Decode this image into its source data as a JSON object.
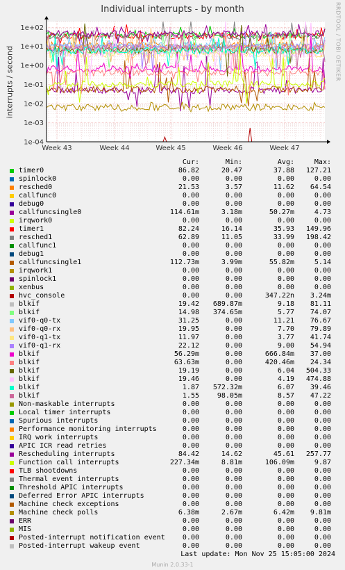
{
  "title": "Individual interrupts - by month",
  "ylabel": "interrupts / second",
  "credit": "RRDTOOL / TOBI OETIKER",
  "legend_headers": {
    "cur": "Cur:",
    "min": "Min:",
    "avg": "Avg:",
    "max": "Max:"
  },
  "footer": {
    "last_update": "Last update:  Mon Nov 25 15:05:00 2024",
    "version": "Munin 2.0.33-1"
  },
  "chart_data": {
    "type": "line",
    "title": "Individual interrupts - by month",
    "ylabel": "interrupts / second",
    "xlabel": "",
    "y_scale": "log",
    "ylim": [
      0.0001,
      200
    ],
    "y_ticks": [
      "1e+02",
      "1e+01",
      "1e+00",
      "1e-01",
      "1e-02",
      "1e-03",
      "1e-04"
    ],
    "x_ticks": [
      "Week 43",
      "Week 44",
      "Week 45",
      "Week 46",
      "Week 47"
    ],
    "grid": true,
    "legend_position": "bottom",
    "series": [
      {
        "name": "timer0",
        "color": "#00cc00",
        "cur": "86.82",
        "min": "20.47",
        "avg": "37.88",
        "max": "127.21"
      },
      {
        "name": "spinlock0",
        "color": "#0066b3",
        "cur": "0.00",
        "min": "0.00",
        "avg": "0.00",
        "max": "0.00"
      },
      {
        "name": "resched0",
        "color": "#ff8000",
        "cur": "21.53",
        "min": "3.57",
        "avg": "11.62",
        "max": "64.54"
      },
      {
        "name": "callfunc0",
        "color": "#ffcc00",
        "cur": "0.00",
        "min": "0.00",
        "avg": "0.00",
        "max": "0.00"
      },
      {
        "name": "debug0",
        "color": "#330099",
        "cur": "0.00",
        "min": "0.00",
        "avg": "0.00",
        "max": "0.00"
      },
      {
        "name": "callfuncsingle0",
        "color": "#990099",
        "cur": "114.61m",
        "min": "3.18m",
        "avg": "50.27m",
        "max": "4.73"
      },
      {
        "name": "irqwork0",
        "color": "#ccff00",
        "cur": "0.00",
        "min": "0.00",
        "avg": "0.00",
        "max": "0.00"
      },
      {
        "name": "timer1",
        "color": "#ff0000",
        "cur": "82.24",
        "min": "16.14",
        "avg": "35.93",
        "max": "149.96"
      },
      {
        "name": "resched1",
        "color": "#808080",
        "cur": "62.89",
        "min": "11.05",
        "avg": "33.99",
        "max": "198.42"
      },
      {
        "name": "callfunc1",
        "color": "#008f00",
        "cur": "0.00",
        "min": "0.00",
        "avg": "0.00",
        "max": "0.00"
      },
      {
        "name": "debug1",
        "color": "#00487d",
        "cur": "0.00",
        "min": "0.00",
        "avg": "0.00",
        "max": "0.00"
      },
      {
        "name": "callfuncsingle1",
        "color": "#b35a00",
        "cur": "112.73m",
        "min": "3.99m",
        "avg": "55.82m",
        "max": "5.14"
      },
      {
        "name": "irqwork1",
        "color": "#b38f00",
        "cur": "0.00",
        "min": "0.00",
        "avg": "0.00",
        "max": "0.00"
      },
      {
        "name": "spinlock1",
        "color": "#6b006b",
        "cur": "0.00",
        "min": "0.00",
        "avg": "0.00",
        "max": "0.00"
      },
      {
        "name": "xenbus",
        "color": "#8fb300",
        "cur": "0.00",
        "min": "0.00",
        "avg": "0.00",
        "max": "0.00"
      },
      {
        "name": "hvc_console",
        "color": "#b30000",
        "cur": "0.00",
        "min": "0.00",
        "avg": "347.22n",
        "max": "3.24m"
      },
      {
        "name": "blkif",
        "color": "#bebebe",
        "cur": "19.42",
        "min": "689.87m",
        "avg": "9.18",
        "max": "81.11"
      },
      {
        "name": "blkif",
        "color": "#80ff80",
        "cur": "14.98",
        "min": "374.65m",
        "avg": "5.77",
        "max": "74.07"
      },
      {
        "name": "vif0-q0-tx",
        "color": "#80c9ff",
        "cur": "31.25",
        "min": "0.00",
        "avg": "11.21",
        "max": "76.67"
      },
      {
        "name": "vif0-q0-rx",
        "color": "#ffc080",
        "cur": "19.95",
        "min": "0.00",
        "avg": "7.70",
        "max": "79.89"
      },
      {
        "name": "vif0-q1-tx",
        "color": "#ffe680",
        "cur": "11.97",
        "min": "0.00",
        "avg": "3.77",
        "max": "41.74"
      },
      {
        "name": "vif0-q1-rx",
        "color": "#aa80ff",
        "cur": "22.12",
        "min": "0.00",
        "avg": "9.00",
        "max": "54.94"
      },
      {
        "name": "blkif",
        "color": "#ee00cc",
        "cur": "56.29m",
        "min": "0.00",
        "avg": "666.84m",
        "max": "37.00"
      },
      {
        "name": "blkif",
        "color": "#ff8080",
        "cur": "63.63m",
        "min": "0.00",
        "avg": "420.46m",
        "max": "24.34"
      },
      {
        "name": "blkif",
        "color": "#666600",
        "cur": "19.19",
        "min": "0.00",
        "avg": "6.04",
        "max": "504.33"
      },
      {
        "name": "blkif",
        "color": "#ffbfff",
        "cur": "19.46",
        "min": "0.00",
        "avg": "4.19",
        "max": "474.88"
      },
      {
        "name": "blkif",
        "color": "#00ffcc",
        "cur": "1.87",
        "min": "572.32m",
        "avg": "6.07",
        "max": "39.46"
      },
      {
        "name": "blkif",
        "color": "#cc6699",
        "cur": "1.55",
        "min": "98.05m",
        "avg": "8.57",
        "max": "47.22"
      },
      {
        "name": "Non-maskable interrupts",
        "color": "#999900",
        "cur": "0.00",
        "min": "0.00",
        "avg": "0.00",
        "max": "0.00"
      },
      {
        "name": "Local timer interrupts",
        "color": "#00cc00",
        "cur": "0.00",
        "min": "0.00",
        "avg": "0.00",
        "max": "0.00"
      },
      {
        "name": "Spurious interrupts",
        "color": "#0066b3",
        "cur": "0.00",
        "min": "0.00",
        "avg": "0.00",
        "max": "0.00"
      },
      {
        "name": "Performance monitoring interrupts",
        "color": "#ff8000",
        "cur": "0.00",
        "min": "0.00",
        "avg": "0.00",
        "max": "0.00"
      },
      {
        "name": "IRQ work interrupts",
        "color": "#ffcc00",
        "cur": "0.00",
        "min": "0.00",
        "avg": "0.00",
        "max": "0.00"
      },
      {
        "name": "APIC ICR read retries",
        "color": "#330099",
        "cur": "0.00",
        "min": "0.00",
        "avg": "0.00",
        "max": "0.00"
      },
      {
        "name": "Rescheduling interrupts",
        "color": "#990099",
        "cur": "84.42",
        "min": "14.62",
        "avg": "45.61",
        "max": "257.77"
      },
      {
        "name": "Function call interrupts",
        "color": "#ccff00",
        "cur": "227.34m",
        "min": "8.81m",
        "avg": "106.09m",
        "max": "9.87"
      },
      {
        "name": "TLB shootdowns",
        "color": "#ff0000",
        "cur": "0.00",
        "min": "0.00",
        "avg": "0.00",
        "max": "0.00"
      },
      {
        "name": "Thermal event interrupts",
        "color": "#808080",
        "cur": "0.00",
        "min": "0.00",
        "avg": "0.00",
        "max": "0.00"
      },
      {
        "name": "Threshold APIC interrupts",
        "color": "#008f00",
        "cur": "0.00",
        "min": "0.00",
        "avg": "0.00",
        "max": "0.00"
      },
      {
        "name": "Deferred Error APIC interrupts",
        "color": "#00487d",
        "cur": "0.00",
        "min": "0.00",
        "avg": "0.00",
        "max": "0.00"
      },
      {
        "name": "Machine check exceptions",
        "color": "#b35a00",
        "cur": "0.00",
        "min": "0.00",
        "avg": "0.00",
        "max": "0.00"
      },
      {
        "name": "Machine check polls",
        "color": "#b38f00",
        "cur": "6.38m",
        "min": "2.67m",
        "avg": "6.42m",
        "max": "9.81m"
      },
      {
        "name": "ERR",
        "color": "#6b006b",
        "cur": "0.00",
        "min": "0.00",
        "avg": "0.00",
        "max": "0.00"
      },
      {
        "name": "MIS",
        "color": "#8fb300",
        "cur": "0.00",
        "min": "0.00",
        "avg": "0.00",
        "max": "0.00"
      },
      {
        "name": "Posted-interrupt notification event",
        "color": "#b30000",
        "cur": "0.00",
        "min": "0.00",
        "avg": "0.00",
        "max": "0.00"
      },
      {
        "name": "Posted-interrupt wakeup event",
        "color": "#bebebe",
        "cur": "0.00",
        "min": "0.00",
        "avg": "0.00",
        "max": "0.00"
      }
    ]
  }
}
